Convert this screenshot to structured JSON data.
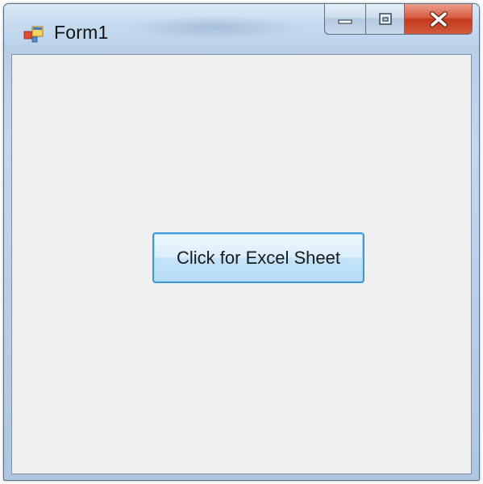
{
  "window": {
    "title": "Form1",
    "icon": "winforms-app-icon",
    "controls": {
      "minimize_icon": "minimize-icon",
      "maximize_icon": "maximize-icon",
      "close_icon": "close-icon"
    }
  },
  "form": {
    "button_label": "Click for Excel Sheet"
  },
  "colors": {
    "client_background": "#f0f0f0",
    "button_border": "#3c9ad6",
    "close_button": "#c94a2c",
    "title_bar": "#c6dbef"
  }
}
